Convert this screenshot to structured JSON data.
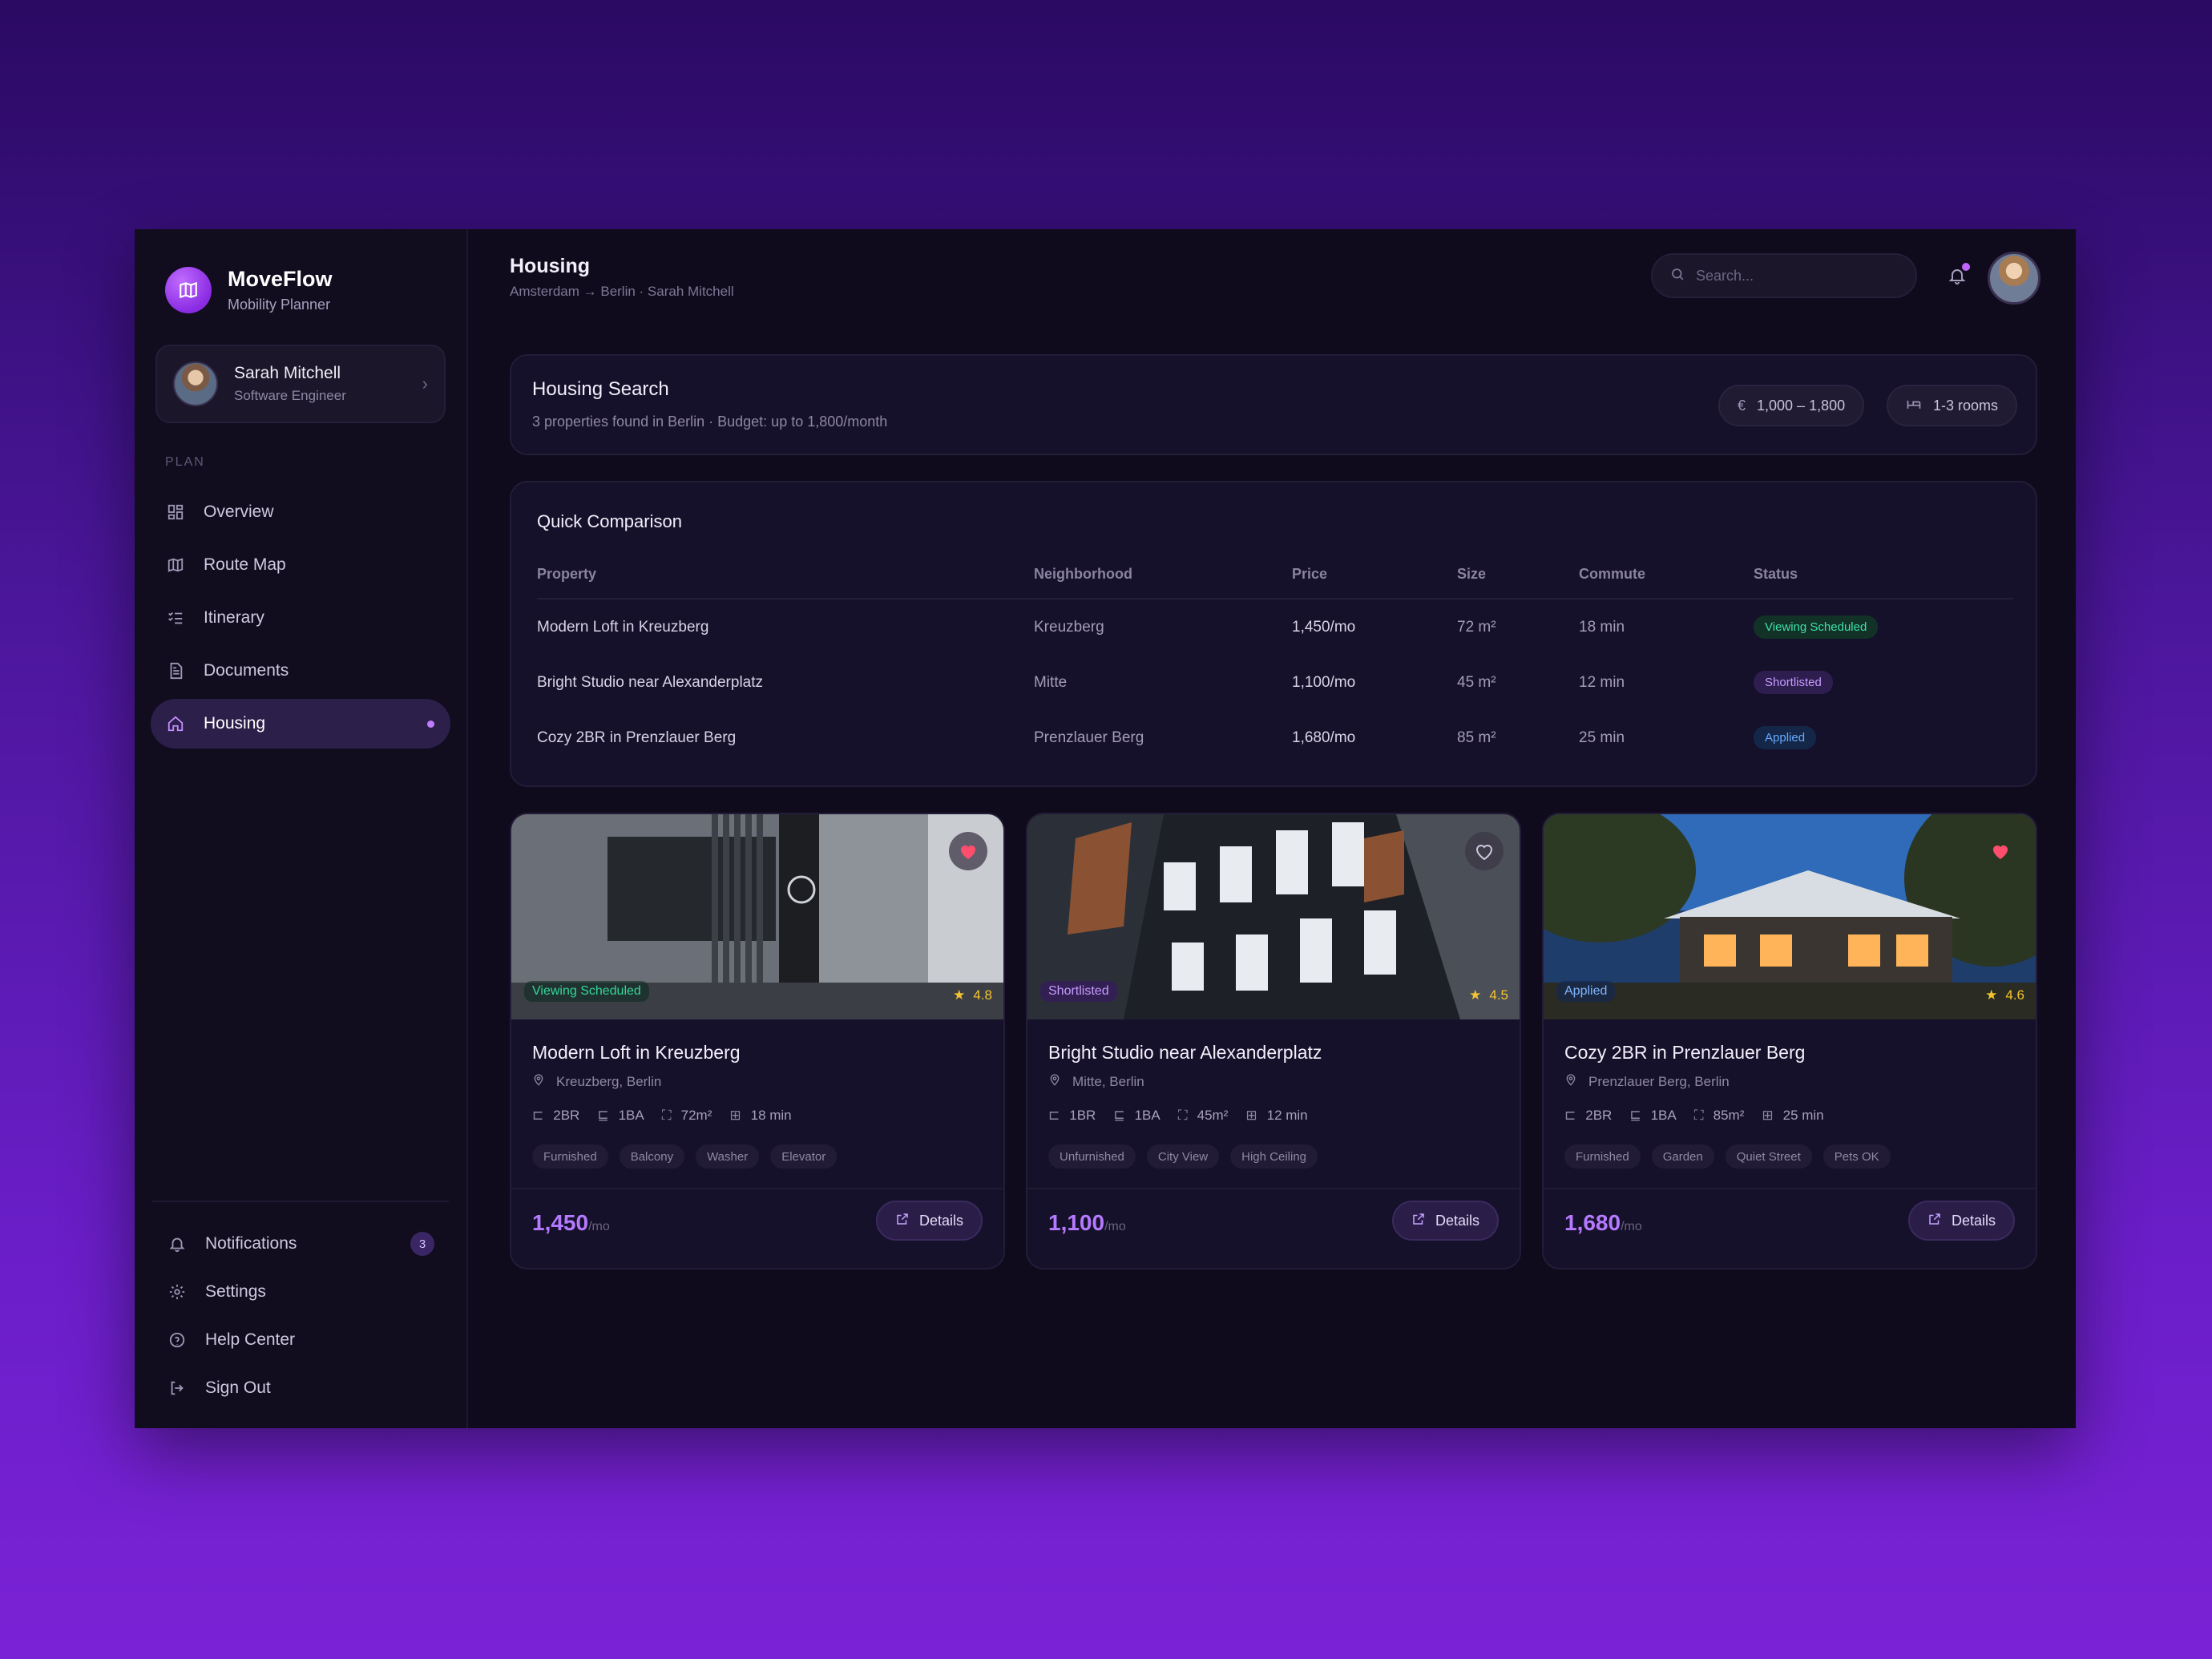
{
  "brand": {
    "name": "MoveFlow",
    "tagline": "Mobility Planner"
  },
  "user": {
    "name": "Sarah Mitchell",
    "role": "Software Engineer"
  },
  "sidebar": {
    "section_label": "PLAN",
    "items": [
      {
        "label": "Overview",
        "icon": "grid-icon"
      },
      {
        "label": "Route Map",
        "icon": "map-icon"
      },
      {
        "label": "Itinerary",
        "icon": "checklist-icon"
      },
      {
        "label": "Documents",
        "icon": "document-icon"
      },
      {
        "label": "Housing",
        "icon": "home-icon",
        "active": true
      }
    ],
    "bottom": [
      {
        "label": "Notifications",
        "icon": "bell-icon",
        "badge": "3"
      },
      {
        "label": "Settings",
        "icon": "gear-icon"
      },
      {
        "label": "Help Center",
        "icon": "help-icon"
      },
      {
        "label": "Sign Out",
        "icon": "logout-icon"
      }
    ]
  },
  "header": {
    "title": "Housing",
    "breadcrumb": "Amsterdam → Berlin · Sarah Mitchell",
    "search_placeholder": "Search..."
  },
  "housing_search": {
    "title": "Housing Search",
    "subtitle": "3 properties found in Berlin · Budget: up to 1,800/month",
    "budget_chip": "1,000 – 1,800",
    "currency_symbol": "€",
    "rooms_chip": "1-3 rooms"
  },
  "comparison": {
    "title": "Quick Comparison",
    "columns": [
      "Property",
      "Neighborhood",
      "Price",
      "Size",
      "Commute",
      "Status"
    ],
    "rows": [
      {
        "property": "Modern Loft in Kreuzberg",
        "neighborhood": "Kreuzberg",
        "price": "1,450/mo",
        "size": "72 m²",
        "commute": "18 min",
        "status": "Viewing Scheduled"
      },
      {
        "property": "Bright Studio near Alexanderplatz",
        "neighborhood": "Mitte",
        "price": "1,100/mo",
        "size": "45 m²",
        "commute": "12 min",
        "status": "Shortlisted"
      },
      {
        "property": "Cozy 2BR in Prenzlauer Berg",
        "neighborhood": "Prenzlauer Berg",
        "price": "1,680/mo",
        "size": "85 m²",
        "commute": "25 min",
        "status": "Applied"
      }
    ]
  },
  "cards": [
    {
      "title": "Modern Loft in Kreuzberg",
      "location": "Kreuzberg, Berlin",
      "beds": "2BR",
      "baths": "1BA",
      "size": "72m²",
      "commute": "18 min",
      "tags": [
        "Furnished",
        "Balcony",
        "Washer",
        "Elevator"
      ],
      "price": "1,450",
      "per": "/mo",
      "status": "Viewing Scheduled",
      "rating": "4.8",
      "favorited": true,
      "details_label": "Details"
    },
    {
      "title": "Bright Studio near Alexanderplatz",
      "location": "Mitte, Berlin",
      "beds": "1BR",
      "baths": "1BA",
      "size": "45m²",
      "commute": "12 min",
      "tags": [
        "Unfurnished",
        "City View",
        "High Ceiling"
      ],
      "price": "1,100",
      "per": "/mo",
      "status": "Shortlisted",
      "rating": "4.5",
      "favorited": false,
      "details_label": "Details"
    },
    {
      "title": "Cozy 2BR in Prenzlauer Berg",
      "location": "Prenzlauer Berg, Berlin",
      "beds": "2BR",
      "baths": "1BA",
      "size": "85m²",
      "commute": "25 min",
      "tags": [
        "Furnished",
        "Garden",
        "Quiet Street",
        "Pets OK"
      ],
      "price": "1,680",
      "per": "/mo",
      "status": "Applied",
      "rating": "4.6",
      "favorited": true,
      "details_label": "Details"
    }
  ],
  "colors": {
    "accent": "#b57aff",
    "status_viewing": "#3fe0a8",
    "status_shortlisted": "#c69bff",
    "status_applied": "#66a9ff",
    "heart": "#ff4d6d",
    "star": "#f4c430"
  }
}
